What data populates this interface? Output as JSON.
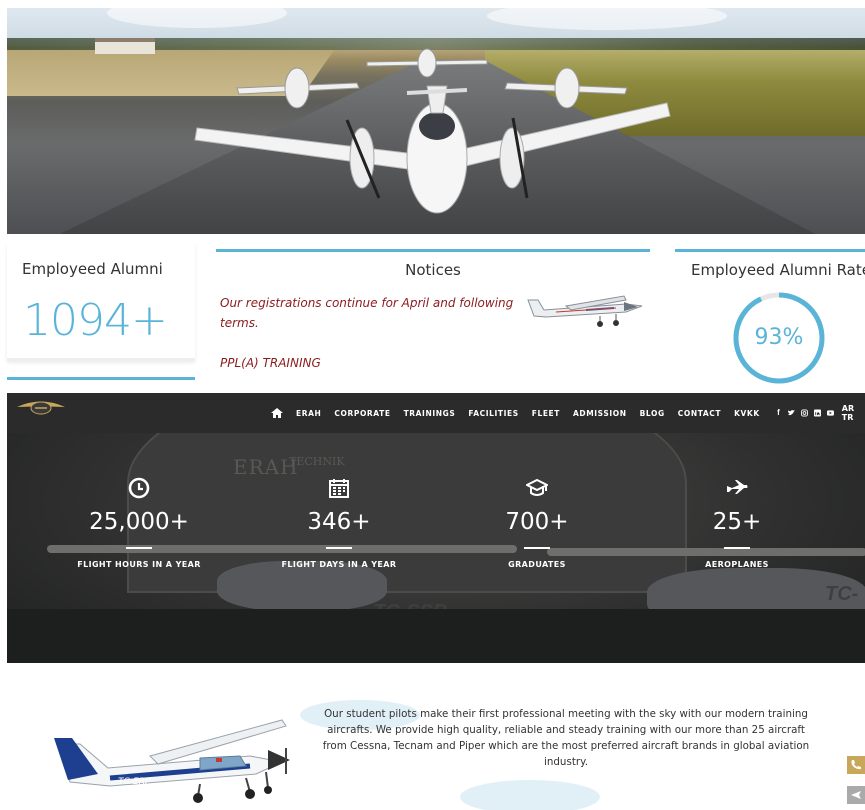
{
  "stats_box_alumni": {
    "title": "Employeed Alumni",
    "count": "1094+"
  },
  "notices": {
    "title": "Notices",
    "text": "Our registrations continue for April and following terms.",
    "text2": "PPL(A) TRAINING"
  },
  "rate_box": {
    "title": "Employeed Alumni Rate",
    "percent": "93%",
    "fraction": 0.93
  },
  "nav": {
    "items": [
      "ERAH",
      "CORPORATE",
      "TRAININGS",
      "FACILITIES",
      "FLEET",
      "ADMISSION",
      "BLOG",
      "CONTACT",
      "KVKK"
    ],
    "lang": "AR TR"
  },
  "stats": [
    {
      "icon": "clock-icon",
      "value": "25,000+",
      "label": "FLIGHT HOURS IN A YEAR"
    },
    {
      "icon": "calendar-icon",
      "value": "346+",
      "label": "FLIGHT DAYS IN A YEAR"
    },
    {
      "icon": "graduation-cap-icon",
      "value": "700+",
      "label": "GRADUATES"
    },
    {
      "icon": "airplane-icon",
      "value": "25+",
      "label": "AEROPLANES"
    }
  ],
  "hangar": {
    "brand": "ERAH",
    "brand2": "TECHNIK",
    "tail1": "TC-SSB",
    "tail2": "TC-EF"
  },
  "fleet": {
    "description": "Our student pilots make their first professional meeting with the sky with our modern training aircrafts. We provide high quality, reliable and steady training with our more than 25 aircraft from Cessna, Tecnam and Piper which are the most preferred aircraft brands in global aviation industry.",
    "plane_tail": "TC-ERP"
  },
  "colors": {
    "accent": "#5ab4d8",
    "notice": "#8b1c1c",
    "nav_bg": "#2b2b2b"
  }
}
